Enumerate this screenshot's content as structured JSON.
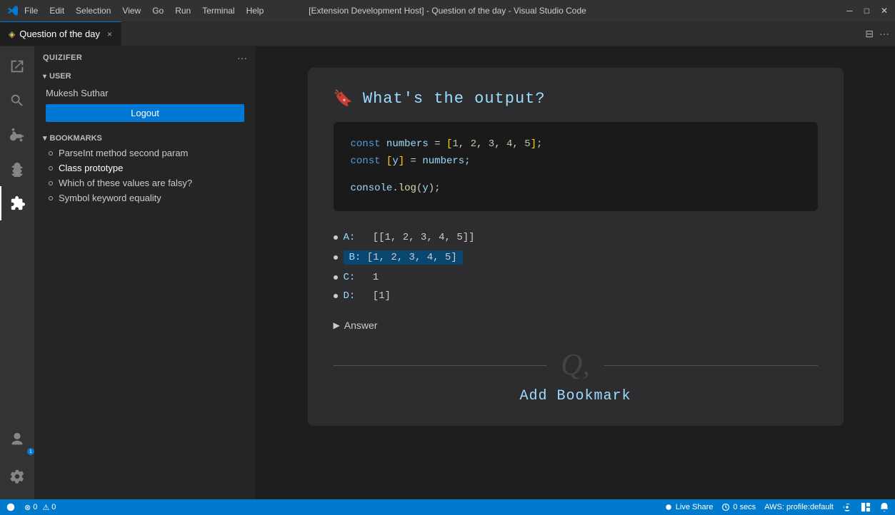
{
  "titlebar": {
    "title": "[Extension Development Host] - Question of the day - Visual Studio Code",
    "menu": [
      "File",
      "Edit",
      "Selection",
      "View",
      "Go",
      "Run",
      "Terminal",
      "Help"
    ],
    "controls": [
      "─",
      "□",
      "✕"
    ]
  },
  "tab": {
    "icon": "◈",
    "label": "Question of the day",
    "close": "×"
  },
  "sidebar": {
    "title": "QUIZIFER",
    "more_icon": "···",
    "user_section": "USER",
    "user_name": "Mukesh Suthar",
    "logout_label": "Logout",
    "bookmarks_section": "BOOKMARKS",
    "bookmarks": [
      {
        "label": "ParseInt method second param"
      },
      {
        "label": "Class prototype"
      },
      {
        "label": "Which of these values are falsy?"
      },
      {
        "label": "Symbol keyword equality"
      }
    ]
  },
  "question": {
    "title": "What's the output?",
    "code_lines": [
      {
        "parts": [
          {
            "type": "kw",
            "text": "const "
          },
          {
            "type": "var",
            "text": "numbers"
          },
          {
            "type": "op",
            "text": " = "
          },
          {
            "type": "bracket",
            "text": "["
          },
          {
            "type": "num",
            "text": "1"
          },
          {
            "type": "op",
            "text": ", "
          },
          {
            "type": "num",
            "text": "2"
          },
          {
            "type": "op",
            "text": ", "
          },
          {
            "type": "num",
            "text": "3"
          },
          {
            "type": "op",
            "text": ", "
          },
          {
            "type": "num",
            "text": "4"
          },
          {
            "type": "op",
            "text": ", "
          },
          {
            "type": "num",
            "text": "5"
          },
          {
            "type": "bracket",
            "text": "]"
          },
          {
            "type": "op",
            "text": ";"
          }
        ]
      },
      {
        "parts": [
          {
            "type": "kw",
            "text": "const "
          },
          {
            "type": "bracket",
            "text": "["
          },
          {
            "type": "var",
            "text": "y"
          },
          {
            "type": "bracket",
            "text": "]"
          },
          {
            "type": "op",
            "text": " = "
          },
          {
            "type": "var",
            "text": "numbers"
          },
          {
            "type": "op",
            "text": ";"
          }
        ]
      },
      {
        "parts": []
      },
      {
        "parts": [
          {
            "type": "var",
            "text": "console"
          },
          {
            "type": "op",
            "text": "."
          },
          {
            "type": "fn",
            "text": "log"
          },
          {
            "type": "op",
            "text": "("
          },
          {
            "type": "var",
            "text": "y"
          },
          {
            "type": "op",
            "text": ");"
          }
        ]
      }
    ],
    "options": [
      {
        "label": "A:",
        "value": "[[1, 2, 3, 4, 5]]",
        "highlighted": false
      },
      {
        "label": "B:",
        "value": "[1, 2, 3, 4, 5]",
        "highlighted": true
      },
      {
        "label": "C:",
        "value": "1",
        "highlighted": false
      },
      {
        "label": "D:",
        "value": "[1]",
        "highlighted": false
      }
    ],
    "answer_label": "Answer"
  },
  "bottom": {
    "watermark": "Q,",
    "add_bookmark": "Add Bookmark"
  },
  "statusbar": {
    "errors": "⊗ 0",
    "warnings": "⚠ 0",
    "live_share": "Live Share",
    "timer": "0 secs",
    "profile": "AWS: profile:default",
    "bell": "🔔",
    "layout": "⊟"
  }
}
